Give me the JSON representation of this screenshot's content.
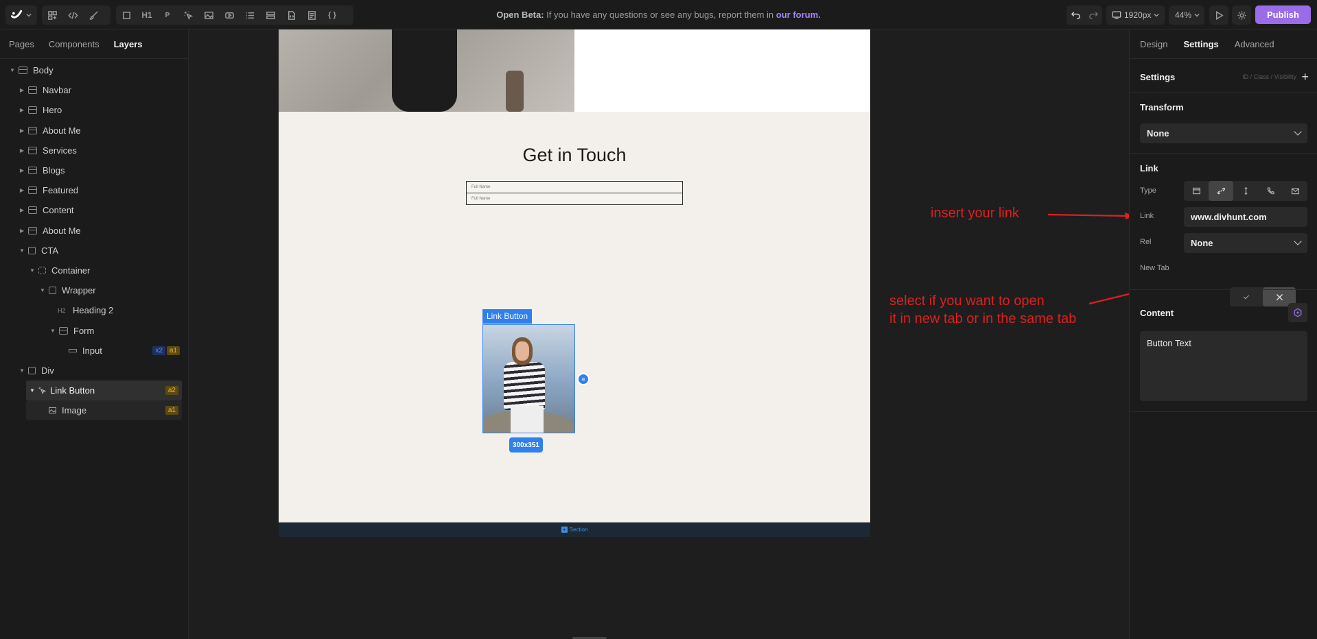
{
  "topbar": {
    "heading_tag": "H1",
    "paragraph_tag": "P",
    "code_tag": "{ }",
    "notice_prefix": "Open Beta:",
    "notice_text": " If you have any questions or see any bugs, report them in ",
    "notice_link": "our forum.",
    "viewport": "1920px",
    "zoom": "44%",
    "publish": "Publish"
  },
  "left_panel": {
    "tabs": [
      "Pages",
      "Components",
      "Layers"
    ],
    "layers": [
      {
        "label": "Body"
      },
      {
        "label": "Navbar"
      },
      {
        "label": "Hero"
      },
      {
        "label": "About Me"
      },
      {
        "label": "Services"
      },
      {
        "label": "Blogs"
      },
      {
        "label": "Featured"
      },
      {
        "label": "Content"
      },
      {
        "label": "About Me"
      },
      {
        "label": "CTA"
      },
      {
        "label": "Container"
      },
      {
        "label": "Wrapper"
      },
      {
        "label": "Heading 2",
        "tag": "H2"
      },
      {
        "label": "Form"
      },
      {
        "label": "Input",
        "badges": [
          "x2",
          "a1"
        ]
      },
      {
        "label": "Div"
      },
      {
        "label": "Link Button",
        "badges": [
          "a2"
        ]
      },
      {
        "label": "Image",
        "badges": [
          "a1"
        ]
      }
    ]
  },
  "canvas": {
    "heading": "Get in Touch",
    "field_placeholders": [
      "Full Name",
      "Full Name"
    ],
    "selected_label": "Link Button",
    "selected_size": "300x351",
    "section_label": "Section"
  },
  "annotations": {
    "insert_link": "insert your link",
    "new_tab_line1": "select if you want to open",
    "new_tab_line2": "it in new tab or in the same tab"
  },
  "right_panel": {
    "tabs": [
      "Design",
      "Settings",
      "Advanced"
    ],
    "settings_title": "Settings",
    "settings_hint": "ID / Class / Visibility",
    "transform_title": "Transform",
    "transform_value": "None",
    "link_title": "Link",
    "type_label": "Type",
    "link_label": "Link",
    "link_value": "www.divhunt.com",
    "rel_label": "Rel",
    "rel_value": "None",
    "newtab_label": "New Tab",
    "content_title": "Content",
    "content_text": "Button Text"
  },
  "colors": {
    "accent": "#9a6ce8",
    "selection": "#2f80ed",
    "annotation": "#e01f1f"
  }
}
